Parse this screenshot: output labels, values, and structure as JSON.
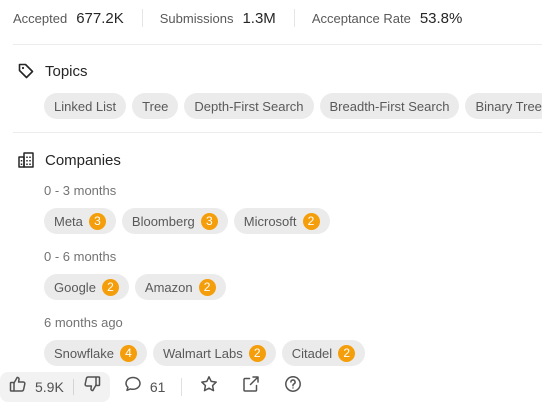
{
  "stats": {
    "accepted_label": "Accepted",
    "accepted_value": "677.2K",
    "submissions_label": "Submissions",
    "submissions_value": "1.3M",
    "acceptance_label": "Acceptance Rate",
    "acceptance_value": "53.8%"
  },
  "topics": {
    "title": "Topics",
    "tags": [
      "Linked List",
      "Tree",
      "Depth-First Search",
      "Breadth-First Search",
      "Binary Tree"
    ]
  },
  "companies": {
    "title": "Companies",
    "groups": [
      {
        "period": "0 - 3 months",
        "items": [
          {
            "name": "Meta",
            "count": "3"
          },
          {
            "name": "Bloomberg",
            "count": "3"
          },
          {
            "name": "Microsoft",
            "count": "2"
          }
        ]
      },
      {
        "period": "0 - 6 months",
        "items": [
          {
            "name": "Google",
            "count": "2"
          },
          {
            "name": "Amazon",
            "count": "2"
          }
        ]
      },
      {
        "period": "6 months ago",
        "items": [
          {
            "name": "Snowflake",
            "count": "4"
          },
          {
            "name": "Walmart Labs",
            "count": "2"
          },
          {
            "name": "Citadel",
            "count": "2"
          }
        ]
      }
    ]
  },
  "toolbar": {
    "likes": "5.9K",
    "comments": "61",
    "icons": [
      "thumbs-up-icon",
      "thumbs-down-icon",
      "comment-icon",
      "star-icon",
      "share-icon",
      "help-icon"
    ]
  },
  "colors": {
    "badge": "#f59e0b",
    "chip_bg": "#ebebeb",
    "text": "#262626"
  }
}
